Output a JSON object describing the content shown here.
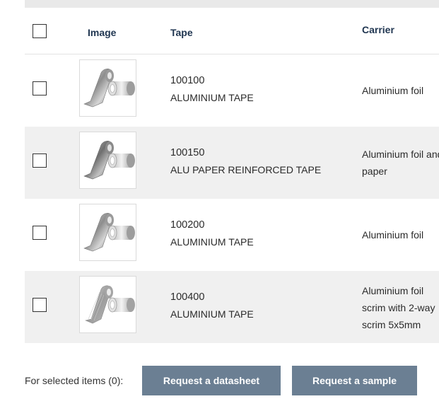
{
  "table": {
    "headers": {
      "image": "Image",
      "tape": "Tape",
      "carrier": "Carrier"
    },
    "rows": [
      {
        "code": "100100",
        "name": "ALUMINIUM TAPE",
        "carrier_lines": [
          "Aluminium foil"
        ]
      },
      {
        "code": "100150",
        "name": "ALU PAPER REINFORCED TAPE",
        "carrier_lines": [
          "Aluminium foil and",
          "paper"
        ]
      },
      {
        "code": "100200",
        "name": "ALUMINIUM TAPE",
        "carrier_lines": [
          "Aluminium foil"
        ]
      },
      {
        "code": "100400",
        "name": "ALUMINIUM TAPE",
        "carrier_lines": [
          "Aluminium foil",
          "scrim with 2-way",
          "scrim 5x5mm"
        ]
      }
    ]
  },
  "footer": {
    "selected_label": "For selected items (0):",
    "datasheet_button": "Request a datasheet",
    "sample_button": "Request a sample"
  },
  "colors": {
    "header_text": "#1f3550",
    "button_bg": "#6b7f93",
    "alt_row_bg": "#f0f0f0"
  }
}
